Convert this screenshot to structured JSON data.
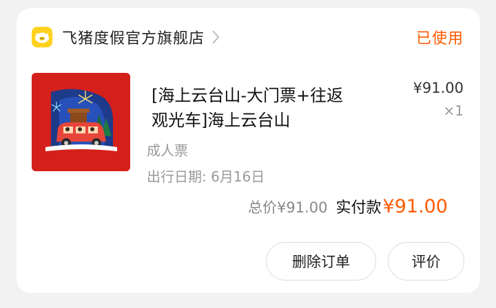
{
  "store": {
    "name": "飞猪度假官方旗舰店",
    "logo_icon": "fliggy-pig-logo-icon",
    "chevron_icon": "chevron-right-icon"
  },
  "order": {
    "status": "已使用",
    "status_color": "#ff5a00",
    "thumbnail_icon": "festive-car-illustration",
    "title_line1": "[海上云台山-大门票+往返",
    "title_line2": "观光车]海上云台山",
    "unit_price": "¥91.00",
    "quantity": "×1",
    "spec": "成人票",
    "date_label": "出行日期: ",
    "date_value": "6月16日"
  },
  "totals": {
    "total_label": "总价",
    "total_value": "¥91.00",
    "paid_label": "实付款",
    "paid_value": "¥91.00"
  },
  "actions": {
    "delete_label": "删除订单",
    "review_label": "评价"
  }
}
